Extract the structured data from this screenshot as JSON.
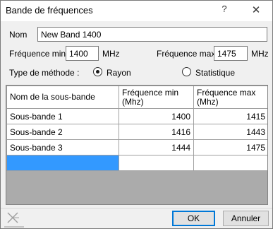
{
  "window": {
    "title": "Bande de fréquences",
    "help_label": "?",
    "close_label": "✕"
  },
  "form": {
    "name_label": "Nom",
    "name_value": "New Band 1400",
    "freq_min_label": "Fréquence min",
    "freq_min_value": "1400",
    "freq_min_unit": "MHz",
    "freq_max_label": "Fréquence max",
    "freq_max_value": "1475",
    "freq_max_unit": "MHz",
    "method_label": "Type de méthode :",
    "method_options": [
      {
        "label": "Rayon",
        "selected": true
      },
      {
        "label": "Statistique",
        "selected": false
      }
    ]
  },
  "table": {
    "headers": [
      "Nom de la sous-bande",
      "Fréquence min\n(Mhz)",
      "Fréquence max\n(Mhz)"
    ],
    "rows": [
      [
        "Sous-bande 1",
        "1400",
        "1415"
      ],
      [
        "Sous-bande 2",
        "1416",
        "1443"
      ],
      [
        "Sous-bande 3",
        "1444",
        "1475"
      ]
    ]
  },
  "footer": {
    "ok_label": "OK",
    "cancel_label": "Annuler",
    "icon": "resize-grip-icon"
  },
  "colors": {
    "selection": "#3399ff",
    "primary_border": "#0078d7",
    "grid_background": "#ababab"
  }
}
